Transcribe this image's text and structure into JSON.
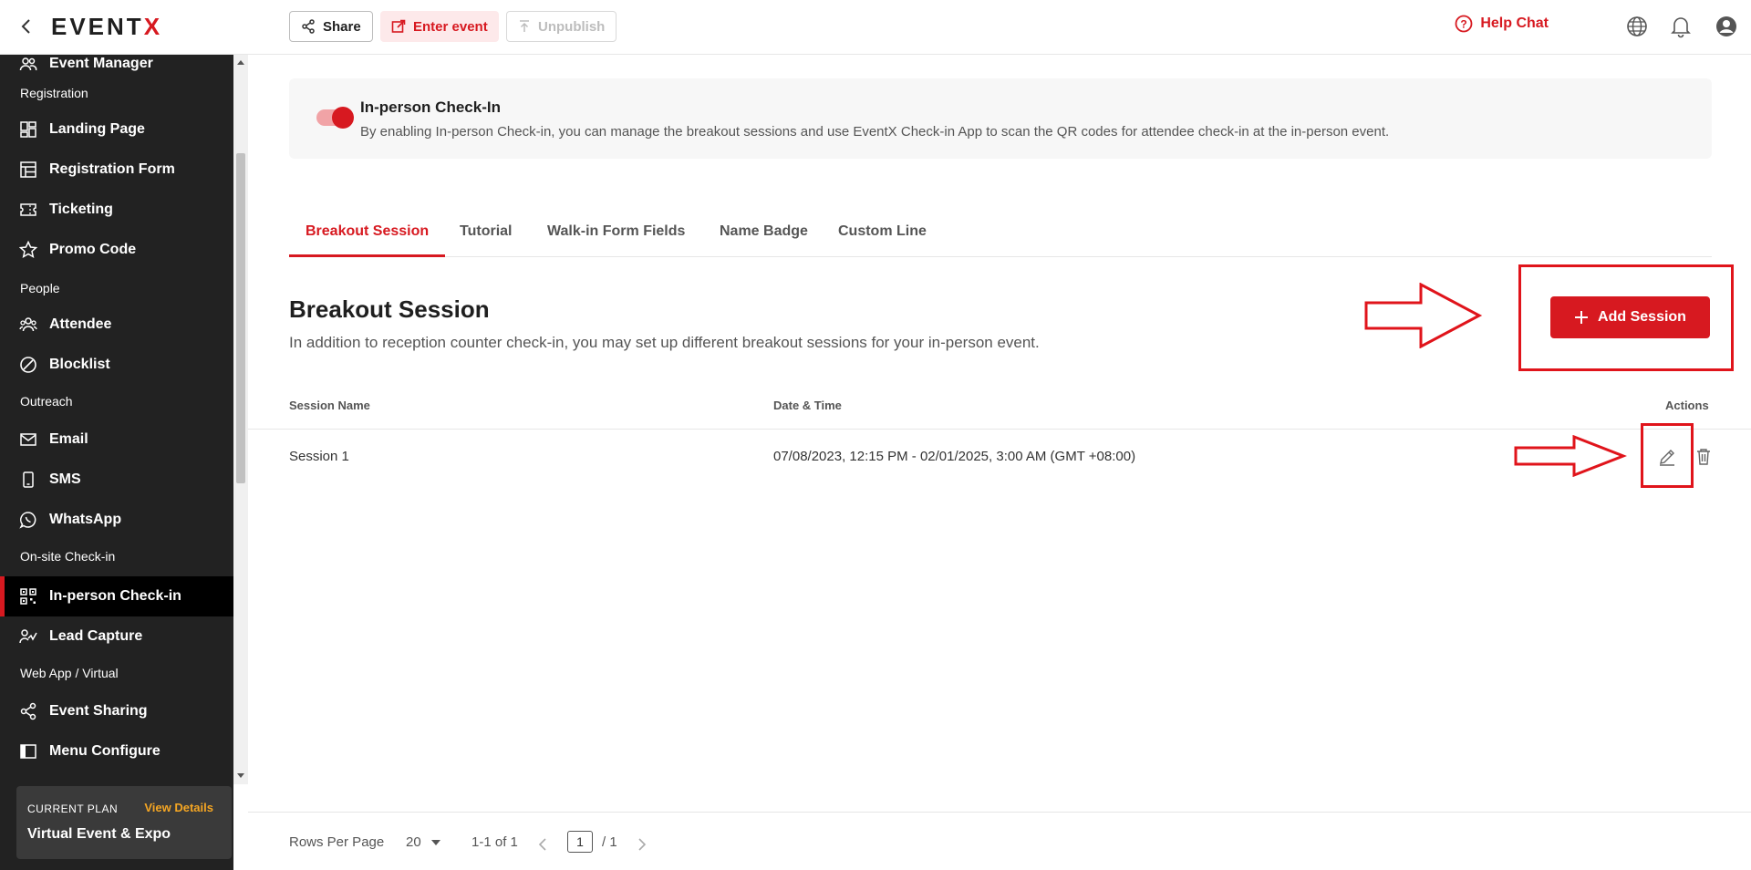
{
  "topbar": {
    "logo_prefix": "EVENT",
    "logo_suffix": "X",
    "share_label": "Share",
    "enter_event_label": "Enter event",
    "unpublish_label": "Unpublish",
    "help_chat_label": "Help Chat"
  },
  "sidebar": {
    "items": [
      {
        "label": "Event Manager"
      },
      {
        "label": "Landing Page"
      },
      {
        "label": "Registration Form"
      },
      {
        "label": "Ticketing"
      },
      {
        "label": "Promo Code"
      },
      {
        "label": "Attendee"
      },
      {
        "label": "Blocklist"
      },
      {
        "label": "Email"
      },
      {
        "label": "SMS"
      },
      {
        "label": "WhatsApp"
      },
      {
        "label": "In-person Check-in"
      },
      {
        "label": "Lead Capture"
      },
      {
        "label": "Event Sharing"
      },
      {
        "label": "Menu Configure"
      }
    ],
    "sections": [
      "Registration",
      "People",
      "Outreach",
      "On-site Check-in",
      "Web App / Virtual"
    ],
    "plan": {
      "label": "CURRENT PLAN",
      "link": "View Details",
      "name": "Virtual Event & Expo"
    }
  },
  "checkin": {
    "enabled": true,
    "title": "In-person Check-In",
    "description": "By enabling In-person Check-in, you can manage the breakout sessions and use EventX Check-in App to scan the QR codes for attendee check-in at the in-person event."
  },
  "tabs": [
    {
      "label": "Breakout Session",
      "active": true
    },
    {
      "label": "Tutorial",
      "active": false
    },
    {
      "label": "Walk-in Form Fields",
      "active": false
    },
    {
      "label": "Name Badge",
      "active": false
    },
    {
      "label": "Custom Line",
      "active": false
    }
  ],
  "breakout": {
    "title": "Breakout Session",
    "description": "In addition to reception counter check-in, you may set up different breakout sessions for your in-person event.",
    "add_button": "Add Session"
  },
  "table": {
    "headers": {
      "name": "Session Name",
      "datetime": "Date & Time",
      "actions": "Actions"
    },
    "rows": [
      {
        "name": "Session 1",
        "datetime": "07/08/2023, 12:15 PM - 02/01/2025, 3:00 AM (GMT +08:00)"
      }
    ]
  },
  "pagination": {
    "rows_per_page_label": "Rows Per Page",
    "rows_per_page": "20",
    "range": "1-1 of 1",
    "current_page": "1",
    "total_pages": "/ 1"
  },
  "colors": {
    "accent": "#d71920",
    "sidebar_bg": "#222222",
    "annotation": "#e0141b"
  }
}
